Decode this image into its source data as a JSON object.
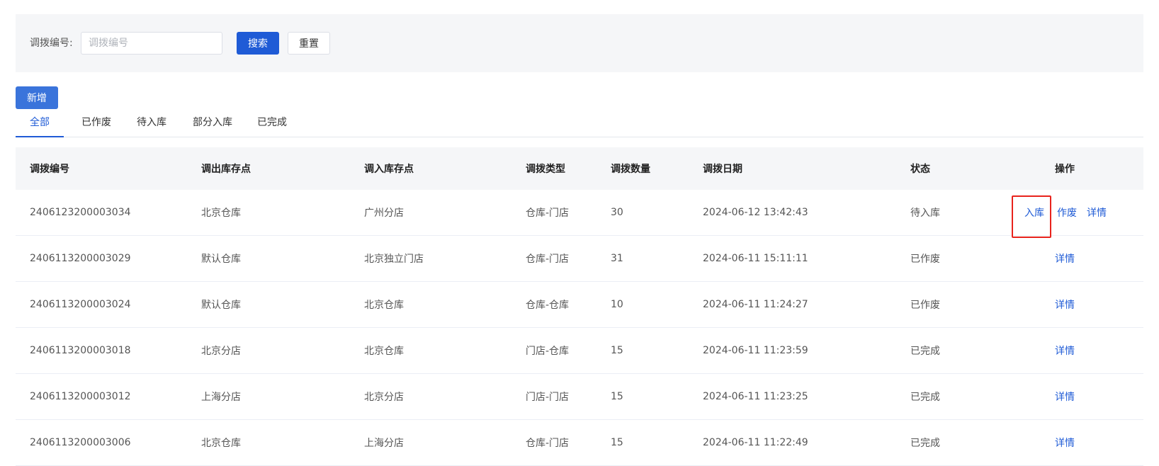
{
  "search": {
    "label": "调拨编号:",
    "input_value": "",
    "placeholder": "调拨编号",
    "search_button": "搜索",
    "reset_button": "重置"
  },
  "toolbar": {
    "add_button": "新增"
  },
  "tabs": [
    {
      "label": "全部",
      "active": true
    },
    {
      "label": "已作废",
      "active": false
    },
    {
      "label": "待入库",
      "active": false
    },
    {
      "label": "部分入库",
      "active": false
    },
    {
      "label": "已完成",
      "active": false
    }
  ],
  "table": {
    "headers": [
      "调拨编号",
      "调出库存点",
      "调入库存点",
      "调拨类型",
      "调拨数量",
      "调拨日期",
      "状态",
      "操作"
    ],
    "rows": [
      {
        "id": "2406123200003034",
        "from": "北京仓库",
        "to": "广州分店",
        "type": "仓库-门店",
        "qty": "30",
        "date": "2024-06-12 13:42:43",
        "status": "待入库",
        "actions": [
          "入库",
          "作废",
          "详情"
        ]
      },
      {
        "id": "2406113200003029",
        "from": "默认仓库",
        "to": "北京独立门店",
        "type": "仓库-门店",
        "qty": "31",
        "date": "2024-06-11 15:11:11",
        "status": "已作废",
        "actions": [
          "详情"
        ]
      },
      {
        "id": "2406113200003024",
        "from": "默认仓库",
        "to": "北京仓库",
        "type": "仓库-仓库",
        "qty": "10",
        "date": "2024-06-11 11:24:27",
        "status": "已作废",
        "actions": [
          "详情"
        ]
      },
      {
        "id": "2406113200003018",
        "from": "北京分店",
        "to": "北京仓库",
        "type": "门店-仓库",
        "qty": "15",
        "date": "2024-06-11 11:23:59",
        "status": "已完成",
        "actions": [
          "详情"
        ]
      },
      {
        "id": "2406113200003012",
        "from": "上海分店",
        "to": "北京分店",
        "type": "门店-门店",
        "qty": "15",
        "date": "2024-06-11 11:23:25",
        "status": "已完成",
        "actions": [
          "详情"
        ]
      },
      {
        "id": "2406113200003006",
        "from": "北京仓库",
        "to": "上海分店",
        "type": "仓库-门店",
        "qty": "15",
        "date": "2024-06-11 11:22:49",
        "status": "已完成",
        "actions": [
          "详情"
        ]
      }
    ]
  },
  "colors": {
    "primary": "#1f5bd6",
    "highlight": "#e8231c"
  }
}
